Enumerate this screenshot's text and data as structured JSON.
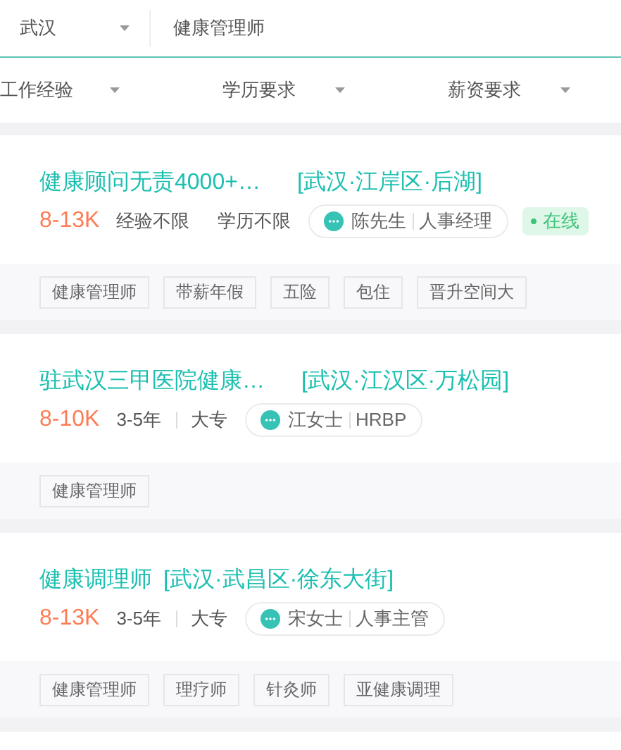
{
  "search_bar": {
    "city": "武汉",
    "query": "健康管理师"
  },
  "filters": [
    {
      "label": "工作经验"
    },
    {
      "label": "学历要求"
    },
    {
      "label": "薪资要求"
    }
  ],
  "jobs": [
    {
      "title": "健康顾问无责4000+…",
      "location": "[武汉·江岸区·后湖]",
      "salary": "8-13K",
      "experience": "经验不限",
      "education": "学历不限",
      "recruiter": "陈先生",
      "recruiter_role": "人事经理",
      "online": true,
      "online_label": "在线",
      "tags": [
        "健康管理师",
        "带薪年假",
        "五险",
        "包住",
        "晋升空间大"
      ]
    },
    {
      "title": "驻武汉三甲医院健康…",
      "location": "[武汉·江汉区·万松园]",
      "salary": "8-10K",
      "experience": "3-5年",
      "education": "大专",
      "recruiter": "江女士",
      "recruiter_role": "HRBP",
      "online": false,
      "tags": [
        "健康管理师"
      ]
    },
    {
      "title": "健康调理师",
      "location": "[武汉·武昌区·徐东大街]",
      "salary": "8-13K",
      "experience": "3-5年",
      "education": "大专",
      "recruiter": "宋女士",
      "recruiter_role": "人事主管",
      "online": false,
      "tags": [
        "健康管理师",
        "理疗师",
        "针灸师",
        "亚健康调理"
      ]
    }
  ]
}
